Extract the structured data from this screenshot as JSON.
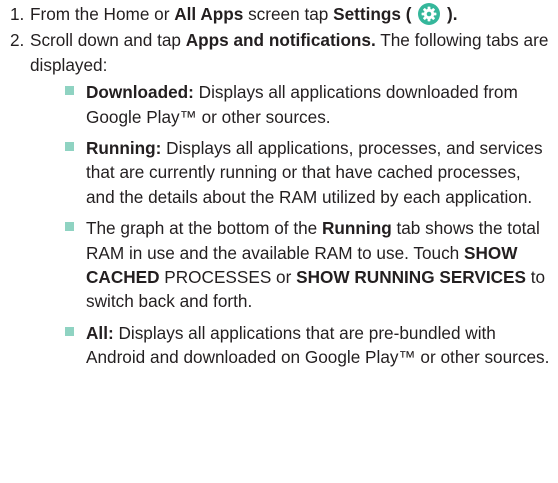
{
  "steps": [
    {
      "number": "1.",
      "text_before": "From the Home or ",
      "bold_1": "All Apps",
      "text_middle": " screen tap ",
      "bold_2": "Settings ( ",
      "icon": "settings-gear-icon",
      "bold_3": " )."
    },
    {
      "number": "2.",
      "text_before": "Scroll down and tap ",
      "bold_1": "Apps and notifications.",
      "text_after": " The following tabs are displayed:"
    }
  ],
  "bullets": [
    {
      "label": "Downloaded:",
      "text": " Displays all applications downloaded from Google Play™ or other sources."
    },
    {
      "label": "Running:",
      "text": " Displays all applications, processes, and services that are currently running or that have cached processes, and the details about the RAM utilized by each application."
    },
    {
      "text_1": "The graph at the bottom of the ",
      "bold_1": "Running",
      "text_2": " tab shows the total RAM in use and the available RAM to use. Touch ",
      "bold_2": "SHOW CACHED",
      "text_3": " PROCESSES or ",
      "bold_3": "SHOW RUNNING SERVICES",
      "text_4": " to switch back and forth."
    },
    {
      "label": "All:",
      "text": " Displays all applications that are pre-bundled with Android and downloaded on Google Play™ or other sources."
    }
  ],
  "colors": {
    "bullet": "#8fd3c2",
    "icon_bg": "#35b79b",
    "text": "#231f20"
  }
}
